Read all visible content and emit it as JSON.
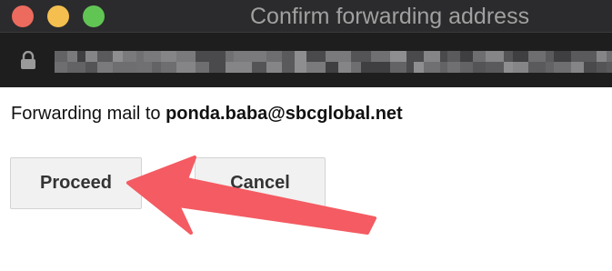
{
  "window": {
    "title": "Confirm forwarding address"
  },
  "address_bar": {
    "icon": "lock-icon"
  },
  "message": {
    "prefix": "Forwarding mail to ",
    "email": "ponda.baba@sbcglobal.net"
  },
  "buttons": {
    "proceed_label": "Proceed",
    "cancel_label": "Cancel"
  },
  "colors": {
    "close": "#ed6a5e",
    "minimize": "#f4bf4f",
    "zoom": "#61c554",
    "annotation_arrow": "#f45b62"
  }
}
